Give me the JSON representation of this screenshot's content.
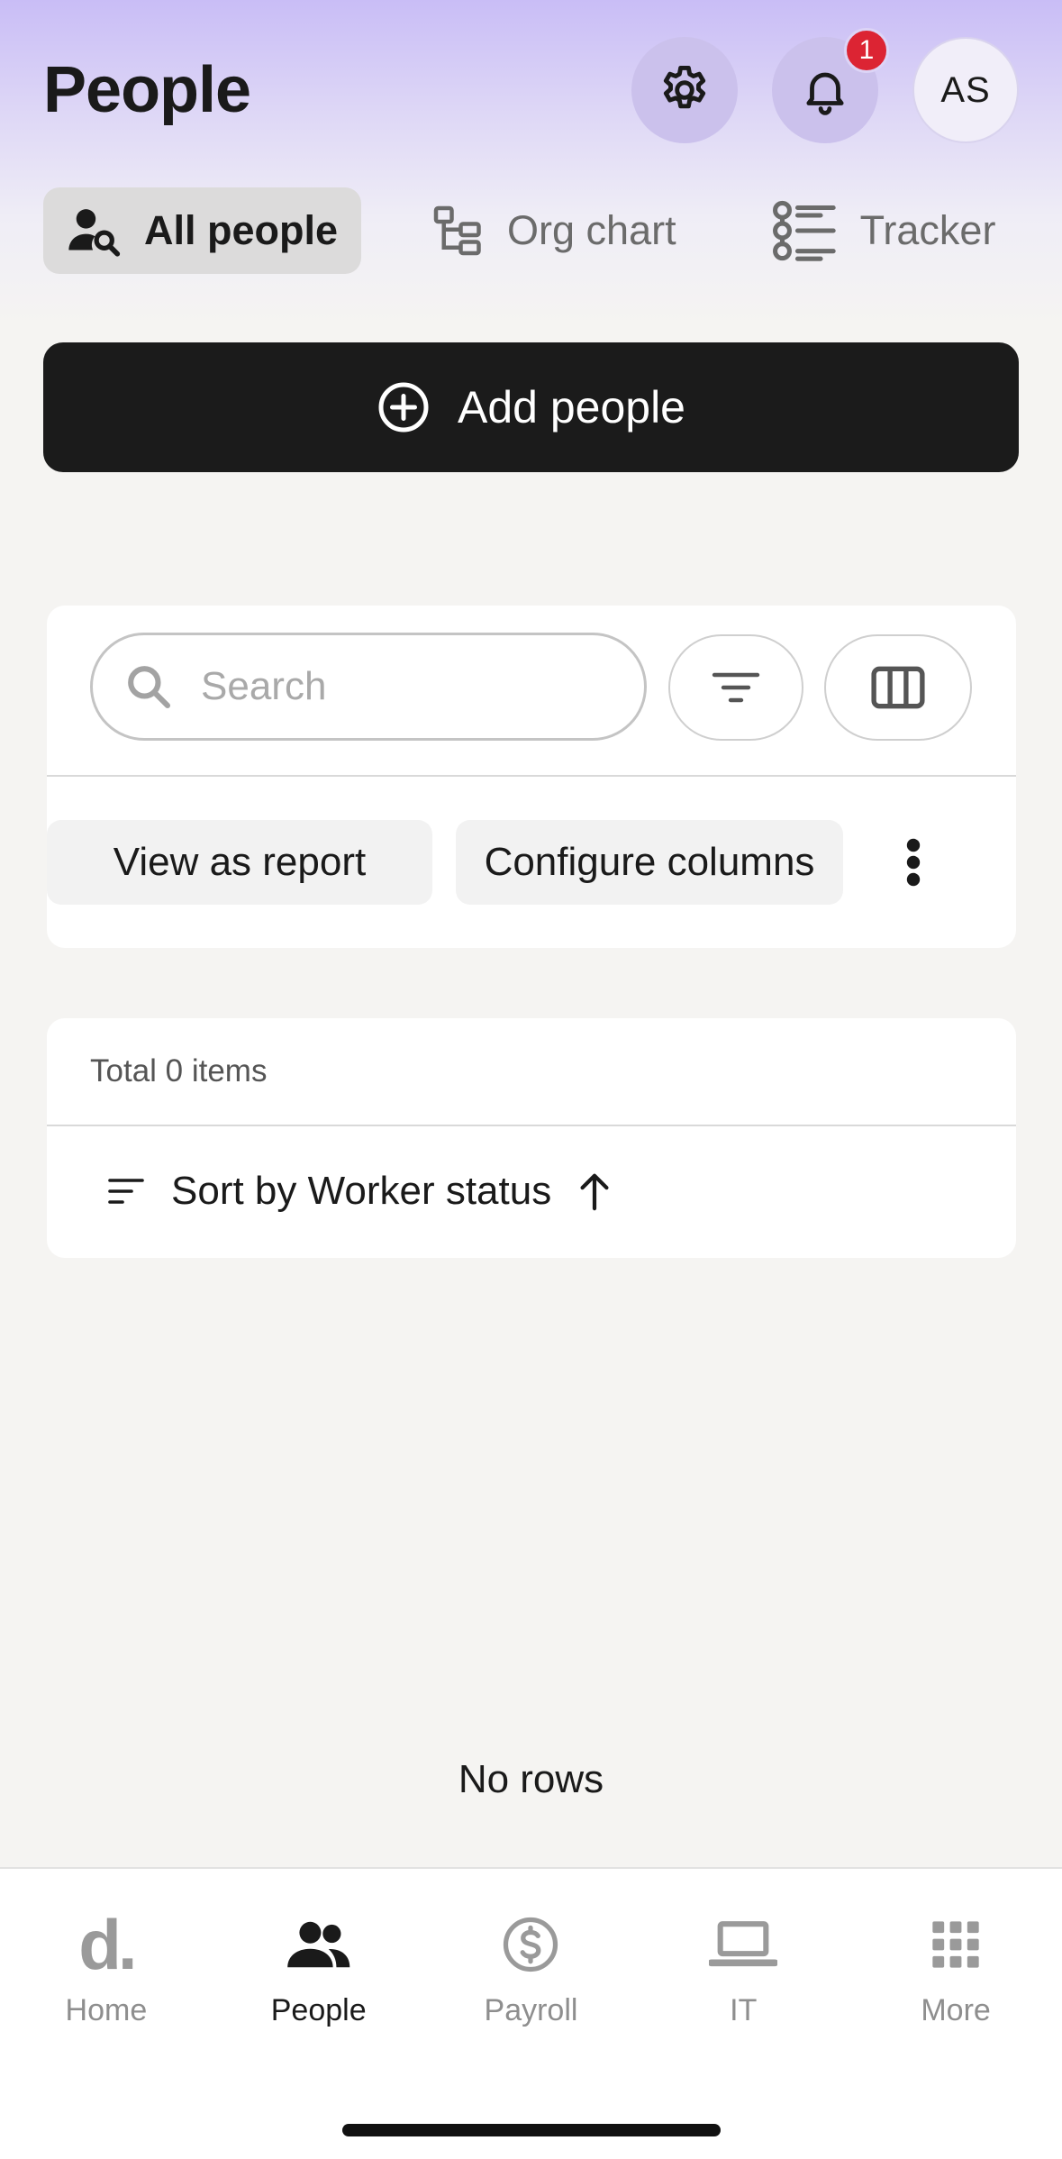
{
  "header": {
    "title": "People",
    "notification_count": "1",
    "avatar_initials": "AS"
  },
  "tabs": [
    {
      "label": "All people",
      "icon": "person-search-icon",
      "active": true
    },
    {
      "label": "Org chart",
      "icon": "org-chart-icon",
      "active": false
    },
    {
      "label": "Tracker",
      "icon": "tracker-list-icon",
      "active": false
    }
  ],
  "add_button": {
    "label": "Add people",
    "icon": "plus-circle-icon"
  },
  "search": {
    "placeholder": "Search",
    "value": ""
  },
  "actions": {
    "view_as_report": "View as report",
    "configure_columns": "Configure columns"
  },
  "table": {
    "total": "Total 0 items",
    "sort_label": "Sort by Worker status",
    "empty": "No rows"
  },
  "bottom_nav": [
    {
      "label": "Home",
      "icon": "deel-logo-icon",
      "active": false
    },
    {
      "label": "People",
      "icon": "people-icon",
      "active": true
    },
    {
      "label": "Payroll",
      "icon": "dollar-circle-icon",
      "active": false
    },
    {
      "label": "IT",
      "icon": "laptop-icon",
      "active": false
    },
    {
      "label": "More",
      "icon": "grid-icon",
      "active": false
    }
  ],
  "home_logo_text": "d.",
  "colors": {
    "primary_button": "#1b1b1b",
    "badge": "#dc2433",
    "header_gradient_top": "#c9bdf6"
  }
}
